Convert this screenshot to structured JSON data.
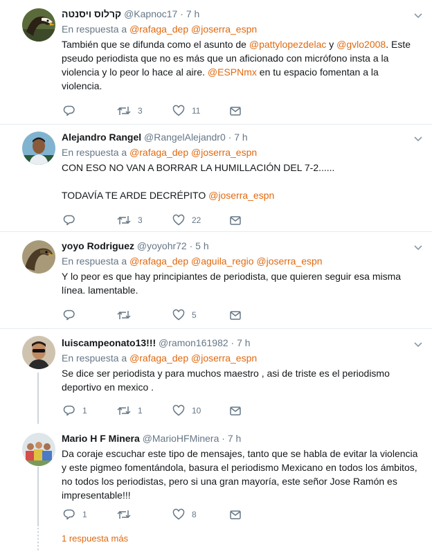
{
  "reply_prefix": "En respuesta a",
  "tweets": [
    {
      "name": "קרלוס ויסנטה",
      "handle": "@Kapnoc17",
      "sep": "·",
      "time": "7 h",
      "mentions": [
        "@rafaga_dep",
        "@joserra_espn"
      ],
      "text_parts": [
        "También que se difunda como el asunto de ",
        "@pattylopezdelac",
        " y ",
        "@gvlo2008",
        ". Este pseudo periodista que no es más que un aficionado con micrófono insta a la violencia y lo peor lo hace al aire. ",
        "@ESPNmx",
        " en tu espacio fomentan a la violencia."
      ],
      "counts": {
        "reply": "",
        "retweet": "3",
        "like": "11"
      }
    },
    {
      "name": "Alejandro Rangel",
      "handle": "@RangelAlejandr0",
      "sep": "·",
      "time": "7 h",
      "mentions": [
        "@rafaga_dep",
        "@joserra_espn"
      ],
      "line1": "CON ESO NO VAN A BORRAR LA HUMILLACIÓN DEL 7-2......",
      "line2": "TODAVÍA TE ARDE DECRÉPITO ",
      "line2_mention": "@joserra_espn",
      "counts": {
        "reply": "",
        "retweet": "3",
        "like": "22"
      }
    },
    {
      "name": "yoyo Rodriguez",
      "handle": "@yoyohr72",
      "sep": "·",
      "time": "5 h",
      "mentions": [
        "@rafaga_dep",
        "@aguila_regio",
        "@joserra_espn"
      ],
      "text": "Y lo peor es que hay principiantes de periodista, que quieren seguir esa misma línea. lamentable.",
      "counts": {
        "reply": "",
        "retweet": "",
        "like": "5"
      }
    },
    {
      "name": "luiscampeonato13!!!",
      "handle": "@ramon161982",
      "sep": "·",
      "time": "7 h",
      "mentions": [
        "@rafaga_dep",
        "@joserra_espn"
      ],
      "text": "Se dice ser periodista y para muchos maestro , asi de triste es el periodismo deportivo en mexico .",
      "counts": {
        "reply": "1",
        "retweet": "1",
        "like": "10"
      }
    },
    {
      "name": "Mario H F Minera",
      "handle": "@MarioHFMinera",
      "sep": "·",
      "time": "7 h",
      "text": "Da coraje escuchar este tipo de mensajes, tanto que se habla de evitar la violencia y este pigmeo fomentándola, basura el periodismo Mexicano en todos los ámbitos, no todos los periodistas, pero si una gran mayoría, este señor Jose Ramón es impresentable!!!",
      "counts": {
        "reply": "1",
        "retweet": "",
        "like": "8"
      }
    }
  ],
  "more_replies": "1 respuesta más",
  "colors": {
    "accent": "#e0690e",
    "muted": "#657786",
    "divider": "#e6ecf0",
    "thread": "#ccd6dd"
  },
  "icons": [
    "chevron-down-icon",
    "reply-icon",
    "retweet-icon",
    "like-icon",
    "message-icon"
  ]
}
